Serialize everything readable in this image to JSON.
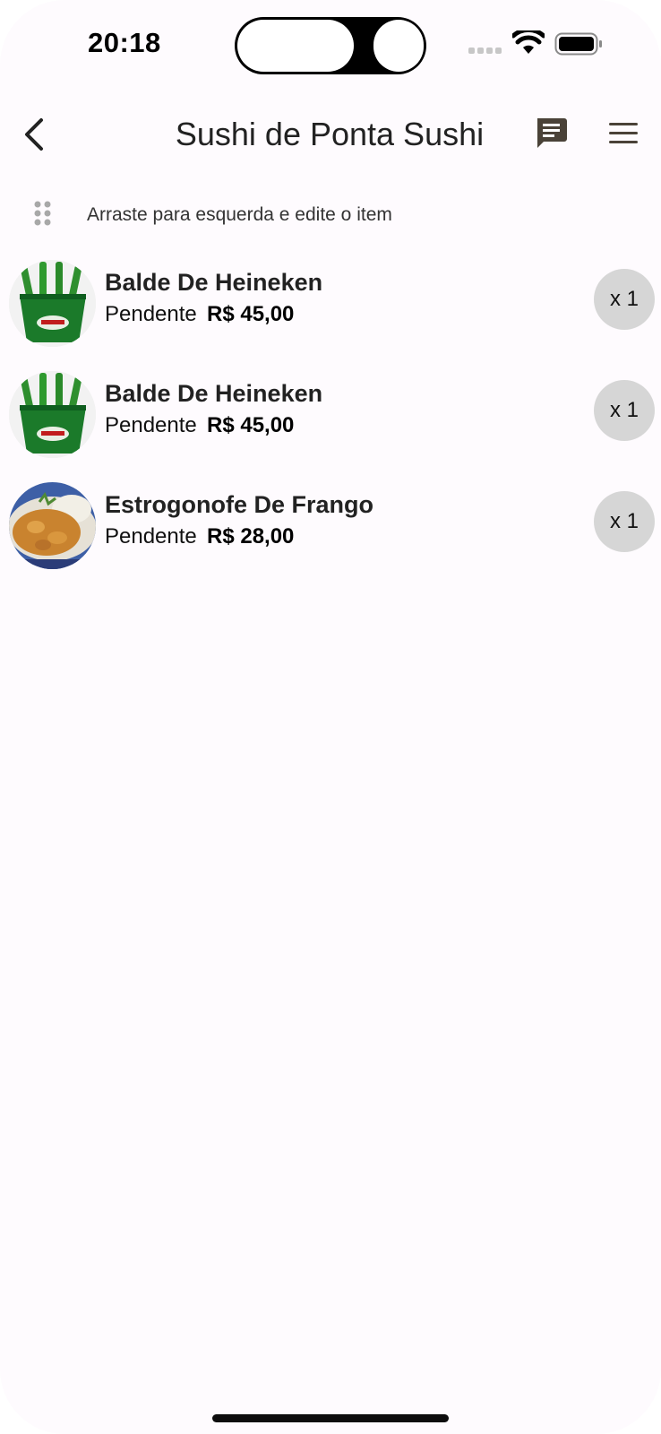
{
  "status_bar": {
    "time": "20:18"
  },
  "header": {
    "title": "Sushi de Ponta Sushi"
  },
  "hint": {
    "text": "Arraste para esquerda e edite o item"
  },
  "items": [
    {
      "name": "Balde De Heineken",
      "status": "Pendente",
      "price": "R$ 45,00",
      "qty": "x 1",
      "image": "heineken-bucket"
    },
    {
      "name": "Balde De Heineken",
      "status": "Pendente",
      "price": "R$ 45,00",
      "qty": "x 1",
      "image": "heineken-bucket"
    },
    {
      "name": "Estrogonofe De Frango",
      "status": "Pendente",
      "price": "R$ 28,00",
      "qty": "x 1",
      "image": "chicken-stroganoff"
    }
  ],
  "colors": {
    "background": "#fefbfe",
    "badge": "#d6d6d6",
    "icon": "#4a4238"
  }
}
